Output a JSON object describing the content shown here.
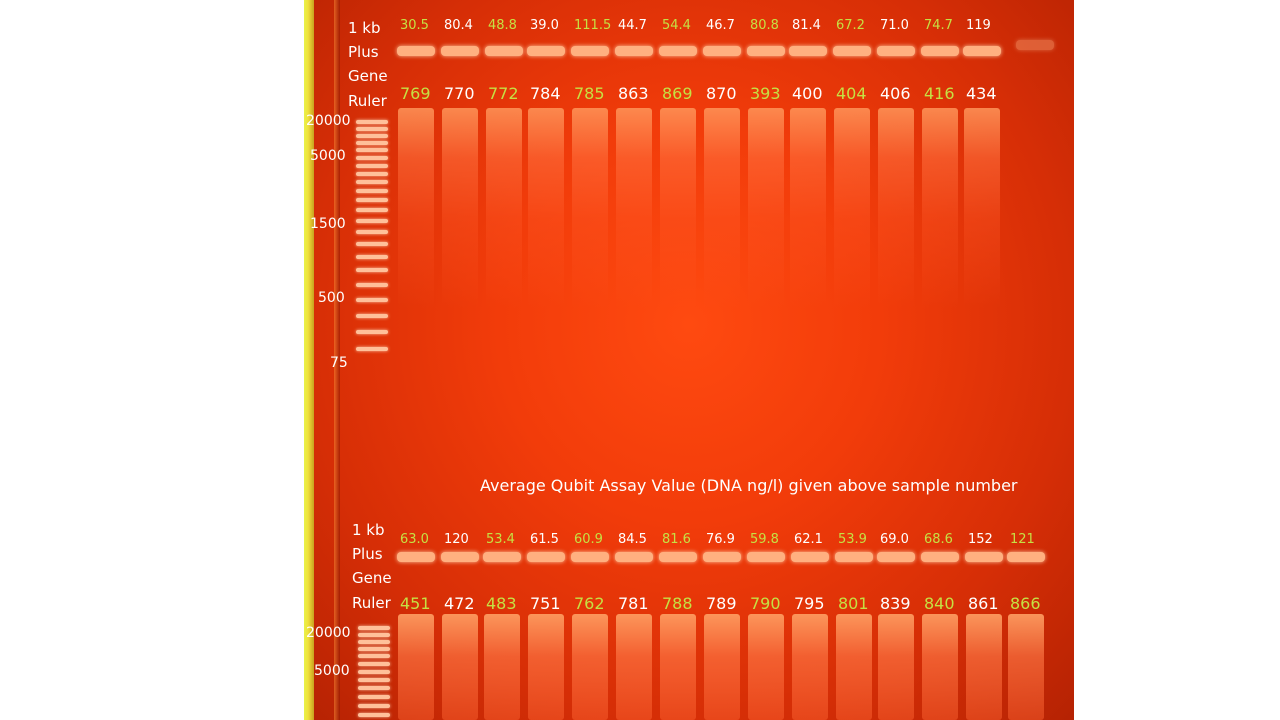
{
  "ladder_label": [
    "1 kb",
    "Plus",
    "Gene",
    "Ruler"
  ],
  "top": {
    "qubit": [
      "30.5",
      "80.4",
      "48.8",
      "39.0",
      "111.5",
      "44.7",
      "54.4",
      "46.7",
      "80.8",
      "81.4",
      "67.2",
      "71.0",
      "74.7",
      "119"
    ],
    "samples": [
      "769",
      "770",
      "772",
      "784",
      "785",
      "863",
      "869",
      "870",
      "393",
      "400",
      "404",
      "406",
      "416",
      "434"
    ],
    "colors": [
      "#c6e043",
      "#ffffff",
      "#c6e043",
      "#ffffff",
      "#c6e043",
      "#ffffff",
      "#c6e043",
      "#ffffff",
      "#c6e043",
      "#ffffff",
      "#c6e043",
      "#ffffff",
      "#c6e043",
      "#ffffff"
    ],
    "size_markers": [
      "20000",
      "5000",
      "1500",
      "500",
      "75"
    ]
  },
  "caption": "Average Qubit Assay Value (DNA ng/l) given above sample number",
  "bottom": {
    "qubit": [
      "63.0",
      "120",
      "53.4",
      "61.5",
      "60.9",
      "84.5",
      "81.6",
      "76.9",
      "59.8",
      "62.1",
      "53.9",
      "69.0",
      "68.6",
      "152",
      "121"
    ],
    "samples": [
      "451",
      "472",
      "483",
      "751",
      "762",
      "781",
      "788",
      "789",
      "790",
      "795",
      "801",
      "839",
      "840",
      "861",
      "866"
    ],
    "colors": [
      "#c6e043",
      "#ffffff",
      "#c6e043",
      "#ffffff",
      "#c6e043",
      "#ffffff",
      "#c6e043",
      "#ffffff",
      "#c6e043",
      "#ffffff",
      "#c6e043",
      "#ffffff",
      "#c6e043",
      "#ffffff",
      "#c6e043"
    ],
    "size_markers": [
      "20000",
      "5000"
    ]
  }
}
